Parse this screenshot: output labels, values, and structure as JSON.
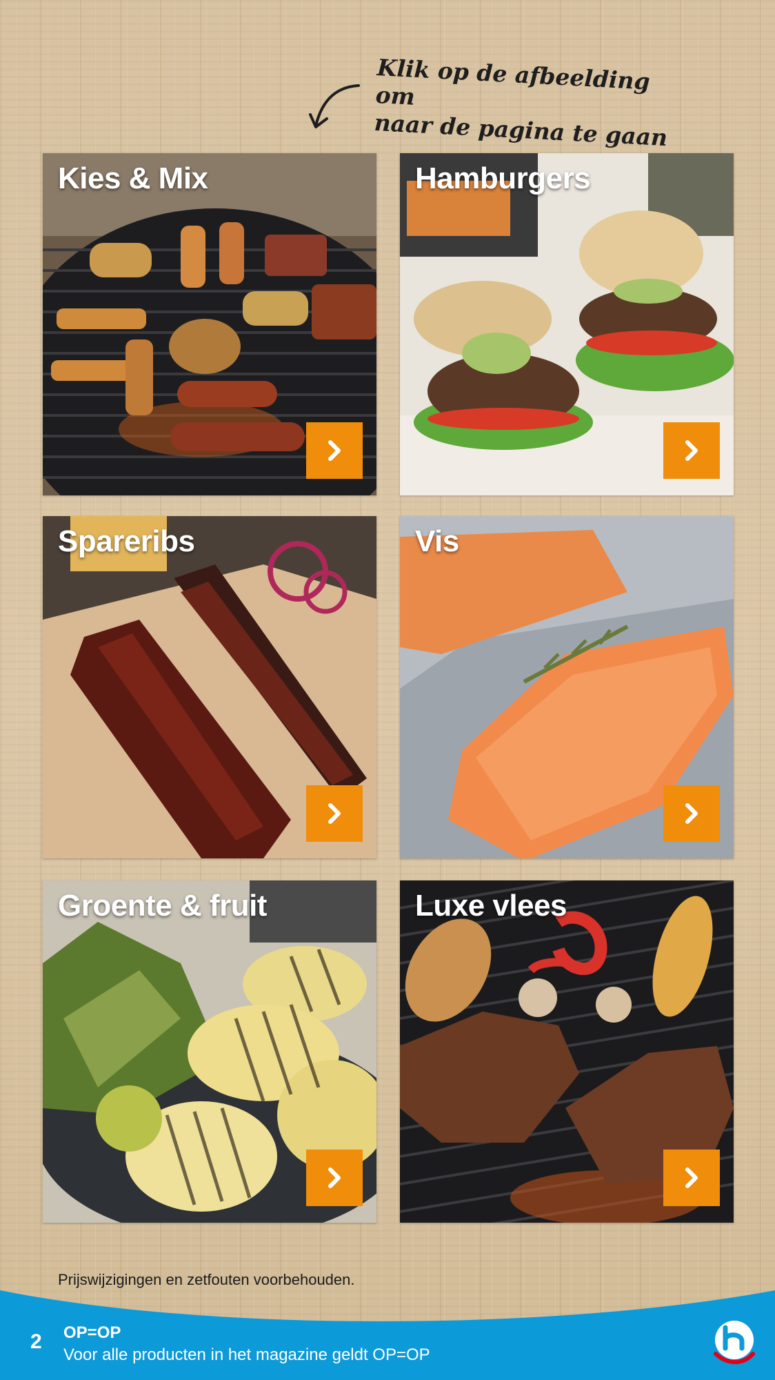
{
  "hint": {
    "line1": "Klik op de afbeelding om",
    "line2": "naar de pagina te gaan"
  },
  "tiles": [
    {
      "label": "Kies & Mix",
      "icon": "chevron-right-icon"
    },
    {
      "label": "Hamburgers",
      "icon": "chevron-right-icon"
    },
    {
      "label": "Spareribs",
      "icon": "chevron-right-icon"
    },
    {
      "label": "Vis",
      "icon": "chevron-right-icon"
    },
    {
      "label": "Groente & fruit",
      "icon": "chevron-right-icon"
    },
    {
      "label": "Luxe vlees",
      "icon": "chevron-right-icon"
    }
  ],
  "disclaimer": "Prijswijzigingen en zetfouten voorbehouden.",
  "footer": {
    "page_number": "2",
    "title": "OP=OP",
    "subtitle": "Voor alle producten in het magazine geldt OP=OP"
  },
  "colors": {
    "accent": "#f08d0a",
    "footer_blue": "#0c9ad8",
    "logo_red": "#e2001a"
  }
}
